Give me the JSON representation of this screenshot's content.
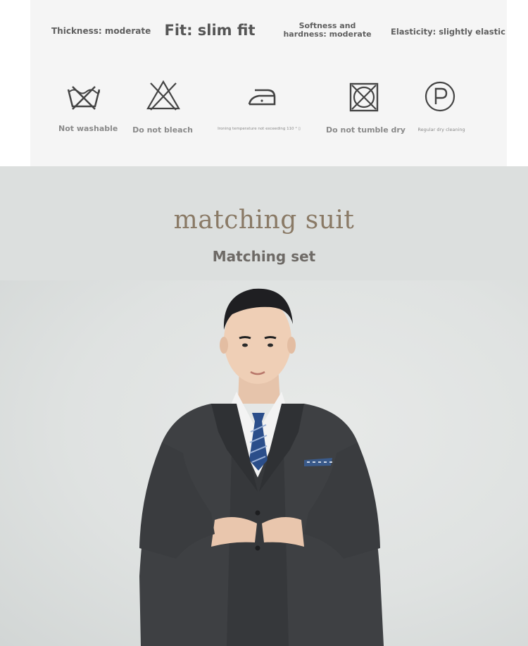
{
  "attributes": {
    "thickness": "Thickness: moderate",
    "fit": "Fit: slim fit",
    "softness": "Softness and hardness: moderate",
    "elasticity": "Elasticity: slightly elastic"
  },
  "care": [
    {
      "icon": "not-washable-icon",
      "label": "Not washable"
    },
    {
      "icon": "do-not-bleach-icon",
      "label": "Do not bleach"
    },
    {
      "icon": "iron-icon",
      "label": "Ironing temperature not exceeding 110 ° ▯"
    },
    {
      "icon": "do-not-tumble-dry-icon",
      "label": "Do not tumble dry"
    },
    {
      "icon": "dry-clean-p-icon",
      "label": "Regular dry cleaning"
    }
  ],
  "section": {
    "title": "matching suit",
    "subtitle": "Matching set"
  },
  "colors": {
    "panel": "#f5f5f5",
    "band": "#dcdfde",
    "title": "#8a7a66",
    "suit": "#3e4043",
    "tie": "#2b4e8a"
  }
}
